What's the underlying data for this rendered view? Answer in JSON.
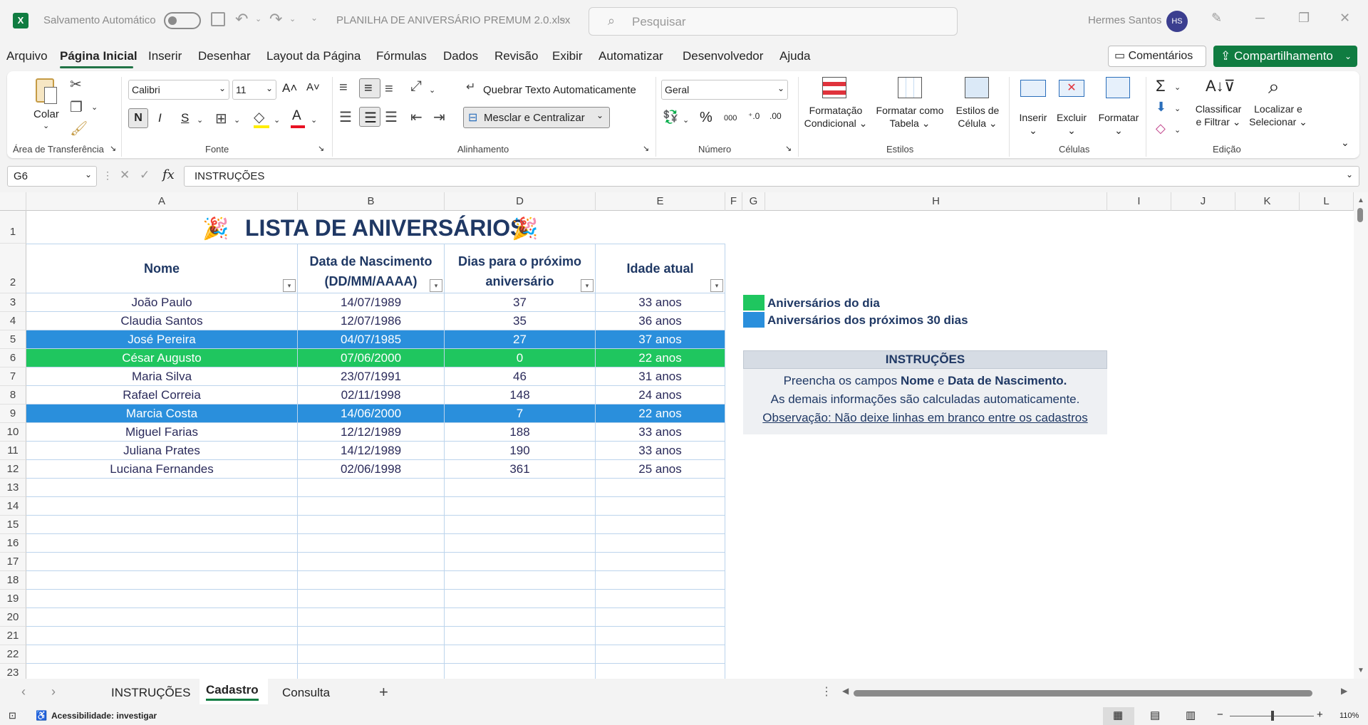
{
  "titlebar": {
    "autosave_label": "Salvamento Automático",
    "filename": "PLANILHA DE ANIVERSÁRIO  PREMUM 2.0.xlsx",
    "search_placeholder": "Pesquisar",
    "user_name": "Hermes Santos",
    "user_initials": "HS"
  },
  "menu": {
    "items": [
      "Arquivo",
      "Página Inicial",
      "Inserir",
      "Desenhar",
      "Layout da Página",
      "Fórmulas",
      "Dados",
      "Revisão",
      "Exibir",
      "Automatizar",
      "Desenvolvedor",
      "Ajuda"
    ],
    "comments_label": "Comentários",
    "share_label": "Compartilhamento"
  },
  "ribbon": {
    "clipboard": {
      "paste_label": "Colar",
      "group_label": "Área de Transferência"
    },
    "font": {
      "font_name": "Calibri",
      "font_size": "11",
      "bold": "N",
      "italic": "I",
      "underline": "S",
      "group_label": "Fonte"
    },
    "alignment": {
      "wrap_label": "Quebrar Texto Automaticamente",
      "merge_label": "Mesclar e Centralizar",
      "group_label": "Alinhamento"
    },
    "number": {
      "format": "Geral",
      "group_label": "Número"
    },
    "styles": {
      "conditional_line1": "Formatação",
      "conditional_line2": "Condicional",
      "table_line1": "Formatar como",
      "table_line2": "Tabela",
      "cell_line1": "Estilos de",
      "cell_line2": "Célula",
      "group_label": "Estilos"
    },
    "cells": {
      "insert_label": "Inserir",
      "delete_label": "Excluir",
      "format_label": "Formatar",
      "group_label": "Células"
    },
    "editing": {
      "sort_line1": "Classificar",
      "sort_line2": "e Filtrar",
      "find_line1": "Localizar e",
      "find_line2": "Selecionar",
      "group_label": "Edição"
    }
  },
  "formula_bar": {
    "name_box": "G6",
    "content": "INSTRUÇÕES"
  },
  "columns": [
    "A",
    "B",
    "D",
    "E",
    "F",
    "G",
    "H",
    "I",
    "J",
    "K",
    "L"
  ],
  "sheet": {
    "title": "LISTA DE ANIVERSÁRIOS",
    "headers": {
      "name": "Nome",
      "birth_line1": "Data de Nascimento",
      "birth_line2": "(DD/MM/AAAA)",
      "days_line1": "Dias para o próximo",
      "days_line2": "aniversário",
      "age": "Idade atual"
    },
    "rows": [
      {
        "row": "3",
        "name": "João Paulo",
        "birth": "14/07/1989",
        "days": "37",
        "age": "33 anos",
        "highlight": "none"
      },
      {
        "row": "4",
        "name": "Claudia Santos",
        "birth": "12/07/1986",
        "days": "35",
        "age": "36 anos",
        "highlight": "none"
      },
      {
        "row": "5",
        "name": "José Pereira",
        "birth": "04/07/1985",
        "days": "27",
        "age": "37 anos",
        "highlight": "blue"
      },
      {
        "row": "6",
        "name": "César Augusto",
        "birth": "07/06/2000",
        "days": "0",
        "age": "22 anos",
        "highlight": "green"
      },
      {
        "row": "7",
        "name": "Maria Silva",
        "birth": "23/07/1991",
        "days": "46",
        "age": "31 anos",
        "highlight": "none"
      },
      {
        "row": "8",
        "name": "Rafael Correia",
        "birth": "02/11/1998",
        "days": "148",
        "age": "24 anos",
        "highlight": "none"
      },
      {
        "row": "9",
        "name": "Marcia Costa",
        "birth": "14/06/2000",
        "days": "7",
        "age": "22 anos",
        "highlight": "blue"
      },
      {
        "row": "10",
        "name": "Miguel Farias",
        "birth": "12/12/1989",
        "days": "188",
        "age": "33 anos",
        "highlight": "none"
      },
      {
        "row": "11",
        "name": "Juliana Prates",
        "birth": "14/12/1989",
        "days": "190",
        "age": "33 anos",
        "highlight": "none"
      },
      {
        "row": "12",
        "name": "Luciana Fernandes",
        "birth": "02/06/1998",
        "days": "361",
        "age": "25 anos",
        "highlight": "none"
      }
    ],
    "empty_rows": [
      "13",
      "14",
      "15",
      "16",
      "17",
      "18",
      "19",
      "20",
      "21",
      "22",
      "23"
    ],
    "legend": {
      "today": "Aniversários do dia",
      "next30": "Aniversários dos próximos 30 dias"
    },
    "instructions": {
      "title": "INSTRUÇÕES",
      "line1_a": "Preencha os campos ",
      "line1_b": "Nome",
      "line1_c": " e ",
      "line1_d": "Data de Nascimento.",
      "line2": "As demais informações são calculadas automaticamente.",
      "line3": "Observação: Não deixe linhas em branco entre os cadastros"
    }
  },
  "tabs": {
    "items": [
      "INSTRUÇÕES",
      "Cadastro",
      "Consulta"
    ],
    "active": "Cadastro"
  },
  "status": {
    "accessibility": "Acessibilidade: investigar",
    "zoom": "110%"
  },
  "colors": {
    "green": "#1fc65f",
    "blue": "#2a8fdc",
    "excel_green": "#107c41",
    "header_text": "#1f3864"
  }
}
